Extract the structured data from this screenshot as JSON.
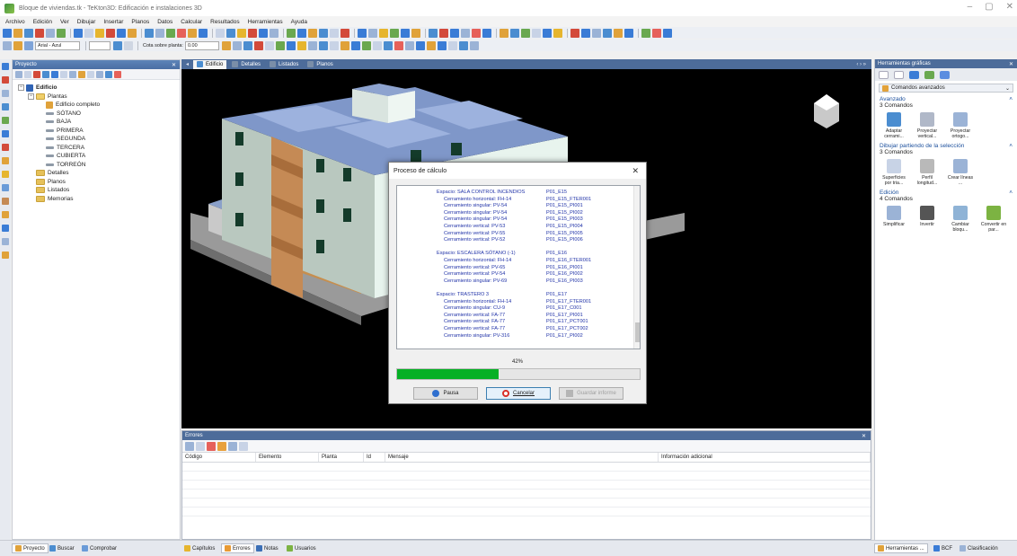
{
  "window": {
    "title": "Bloque de viviendas.tk - TeKton3D: Edificación e instalaciones 3D",
    "controls": [
      "–",
      "▢",
      "✕"
    ]
  },
  "menu": [
    "Archivo",
    "Edición",
    "Ver",
    "Dibujar",
    "Insertar",
    "Planos",
    "Datos",
    "Calcular",
    "Resultados",
    "Herramientas",
    "Ayuda"
  ],
  "toolbar2": {
    "font_combo": "Arial - Azul",
    "cota_label": "Cota sobre planta:",
    "cota_value": "0.00"
  },
  "project_panel": {
    "title": "Proyecto",
    "close": "✕",
    "tree": [
      {
        "label": "Edificio",
        "level": 0,
        "type": "building",
        "expander": "−"
      },
      {
        "label": "Plantas",
        "level": 1,
        "type": "folder",
        "expander": "−"
      },
      {
        "label": "Edificio completo",
        "level": 2,
        "type": "item"
      },
      {
        "label": "SÓTANO",
        "level": 2,
        "type": "leaf"
      },
      {
        "label": "BAJA",
        "level": 2,
        "type": "leaf"
      },
      {
        "label": "PRIMERA",
        "level": 2,
        "type": "leaf"
      },
      {
        "label": "SEGUNDA",
        "level": 2,
        "type": "leaf"
      },
      {
        "label": "TERCERA",
        "level": 2,
        "type": "leaf"
      },
      {
        "label": "CUBIERTA",
        "level": 2,
        "type": "leaf"
      },
      {
        "label": "TORREÓN",
        "level": 2,
        "type": "leaf"
      },
      {
        "label": "Detalles",
        "level": 1,
        "type": "folder"
      },
      {
        "label": "Planos",
        "level": 1,
        "type": "folder"
      },
      {
        "label": "Listados",
        "level": 1,
        "type": "folder"
      },
      {
        "label": "Memorias",
        "level": 1,
        "type": "folder"
      }
    ]
  },
  "doc_tabs": [
    "Edificio",
    "Detalles",
    "Listados",
    "Planos"
  ],
  "doc_nav": "‹ › »",
  "errors_panel": {
    "title": "Errores",
    "close": "✕",
    "columns": [
      "Código",
      "Elemento",
      "Planta",
      "Id",
      "Mensaje",
      "Información adicional"
    ]
  },
  "bottom_tabs_left": [
    "Proyecto",
    "Buscar",
    "Comprobar"
  ],
  "bottom_tabs_mid": [
    "Capítulos",
    "Errores",
    "Notas",
    "Usuarios"
  ],
  "bottom_tabs_right": [
    "Herramientas ...",
    "BCF",
    "Clasificación"
  ],
  "right_panel": {
    "title": "Herramientas gráficas",
    "close": "✕",
    "combo": "Comandos avanzados",
    "groups": [
      {
        "title": "Avanzado",
        "count": "3 Comandos",
        "commands": [
          {
            "label": "Adaptar cerrami...",
            "icon": "adapt-icon"
          },
          {
            "label": "Proyectar vertical...",
            "icon": "project-vertical-icon"
          },
          {
            "label": "Proyectar ortogo...",
            "icon": "project-ortho-icon"
          }
        ]
      },
      {
        "title": "Dibujar partiendo de la selección",
        "count": "3 Comandos",
        "commands": [
          {
            "label": "Superficies por tria...",
            "icon": "triangulate-icon"
          },
          {
            "label": "Perfil longitud...",
            "icon": "profile-icon"
          },
          {
            "label": "Crear líneas ...",
            "icon": "create-lines-icon"
          }
        ]
      },
      {
        "title": "Edición",
        "count": "4 Comandos",
        "commands": [
          {
            "label": "Simplificar",
            "icon": "simplify-icon"
          },
          {
            "label": "Invertir",
            "icon": "invert-icon"
          },
          {
            "label": "Cambiar bloqu...",
            "icon": "change-block-icon"
          },
          {
            "label": "Convertir en par...",
            "icon": "convert-icon"
          }
        ]
      }
    ]
  },
  "dialog": {
    "title": "Proceso de cálculo",
    "close": "✕",
    "progress": 0.42,
    "percent_text": "42%",
    "buttons": {
      "pause": "Pausa",
      "cancel": "Cancelar",
      "save": "Guardar informe"
    },
    "log": [
      {
        "left": "Espacio: SALA CONTROL INCENDIOS",
        "right": "P01_E15",
        "indent": 0
      },
      {
        "left": "Cerramiento horizontal: FH-14",
        "right": "P01_E15_FTER001",
        "indent": 1
      },
      {
        "left": "Cerramiento singular:   PV-54",
        "right": "P01_E15_PI001",
        "indent": 1
      },
      {
        "left": "Cerramiento singular:   PV-54",
        "right": "P01_E15_PI002",
        "indent": 1
      },
      {
        "left": "Cerramiento singular:   PV-54",
        "right": "P01_E15_PI003",
        "indent": 1
      },
      {
        "left": "Cerramiento vertical:   PV-53",
        "right": "P01_E15_PI004",
        "indent": 1
      },
      {
        "left": "Cerramiento vertical:   PV-55",
        "right": "P01_E15_PI005",
        "indent": 1
      },
      {
        "left": "Cerramiento vertical:   PV-52",
        "right": "P01_E15_PI006",
        "indent": 1
      },
      {
        "left": "",
        "right": "",
        "indent": 0
      },
      {
        "left": "Espacio: ESCALERA SÓTANO (-1)",
        "right": "P01_E16",
        "indent": 0
      },
      {
        "left": "Cerramiento horizontal: FH-14",
        "right": "P01_E16_FTER001",
        "indent": 1
      },
      {
        "left": "Cerramiento vertical:   PV-65",
        "right": "P01_E16_PI001",
        "indent": 1
      },
      {
        "left": "Cerramiento vertical:   PV-54",
        "right": "P01_E16_PI002",
        "indent": 1
      },
      {
        "left": "Cerramiento singular:   PV-69",
        "right": "P01_E16_PI003",
        "indent": 1
      },
      {
        "left": "",
        "right": "",
        "indent": 0
      },
      {
        "left": "Espacio: TRASTERO 3",
        "right": "P01_E17",
        "indent": 0
      },
      {
        "left": "Cerramiento horizontal: FH-14",
        "right": "P01_E17_FTER001",
        "indent": 1
      },
      {
        "left": "Cerramiento singular:   CU-9",
        "right": "P01_E17_C001",
        "indent": 1
      },
      {
        "left": "Cerramiento vertical:   FA-77",
        "right": "P01_E17_PI001",
        "indent": 1
      },
      {
        "left": "Cerramiento vertical:   FA-77",
        "right": "P01_E17_PCT001",
        "indent": 1
      },
      {
        "left": "Cerramiento vertical:   FA-77",
        "right": "P01_E17_PCT002",
        "indent": 1
      },
      {
        "left": "Cerramiento singular:   PV-316",
        "right": "P01_E17_PI002",
        "indent": 1
      }
    ]
  }
}
